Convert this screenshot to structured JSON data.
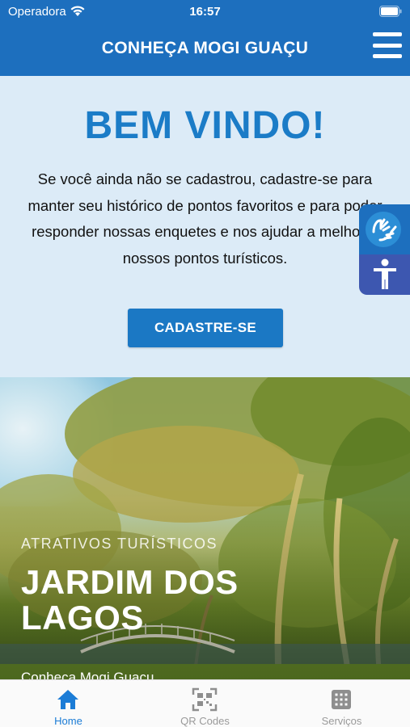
{
  "status_bar": {
    "carrier": "Operadora",
    "time": "16:57"
  },
  "header": {
    "title": "CONHEÇA MOGI GUAÇU",
    "menu_icon": "hamburger-menu-icon"
  },
  "welcome": {
    "title": "BEM VINDO!",
    "text": "Se você ainda não se cadastrou, cadastre-se para manter seu histórico de pontos favoritos e para poder responder nossas enquetes e nos ajudar a melhorar nossos pontos turísticos.",
    "signup_label": "CADASTRE-SE"
  },
  "accessibility": {
    "libras_icon": "sign-language-hands-icon",
    "accessibility_icon": "accessibility-person-icon"
  },
  "hero": {
    "category": "ATRATIVOS TURÍSTICOS",
    "title": "JARDIM DOS LAGOS",
    "subtitle": "Conheça Mogi Guaçu"
  },
  "tabs": [
    {
      "label": "Home",
      "icon": "home-icon",
      "active": true
    },
    {
      "label": "QR Codes",
      "icon": "qr-code-icon",
      "active": false
    },
    {
      "label": "Serviços",
      "icon": "grid-icon",
      "active": false
    }
  ],
  "colors": {
    "brand_blue": "#1d6fbe",
    "title_blue": "#1b7cc7",
    "welcome_bg": "#dcebf7",
    "active_tab": "#1b7cd6",
    "accessibility_purple": "#3d57b0"
  }
}
